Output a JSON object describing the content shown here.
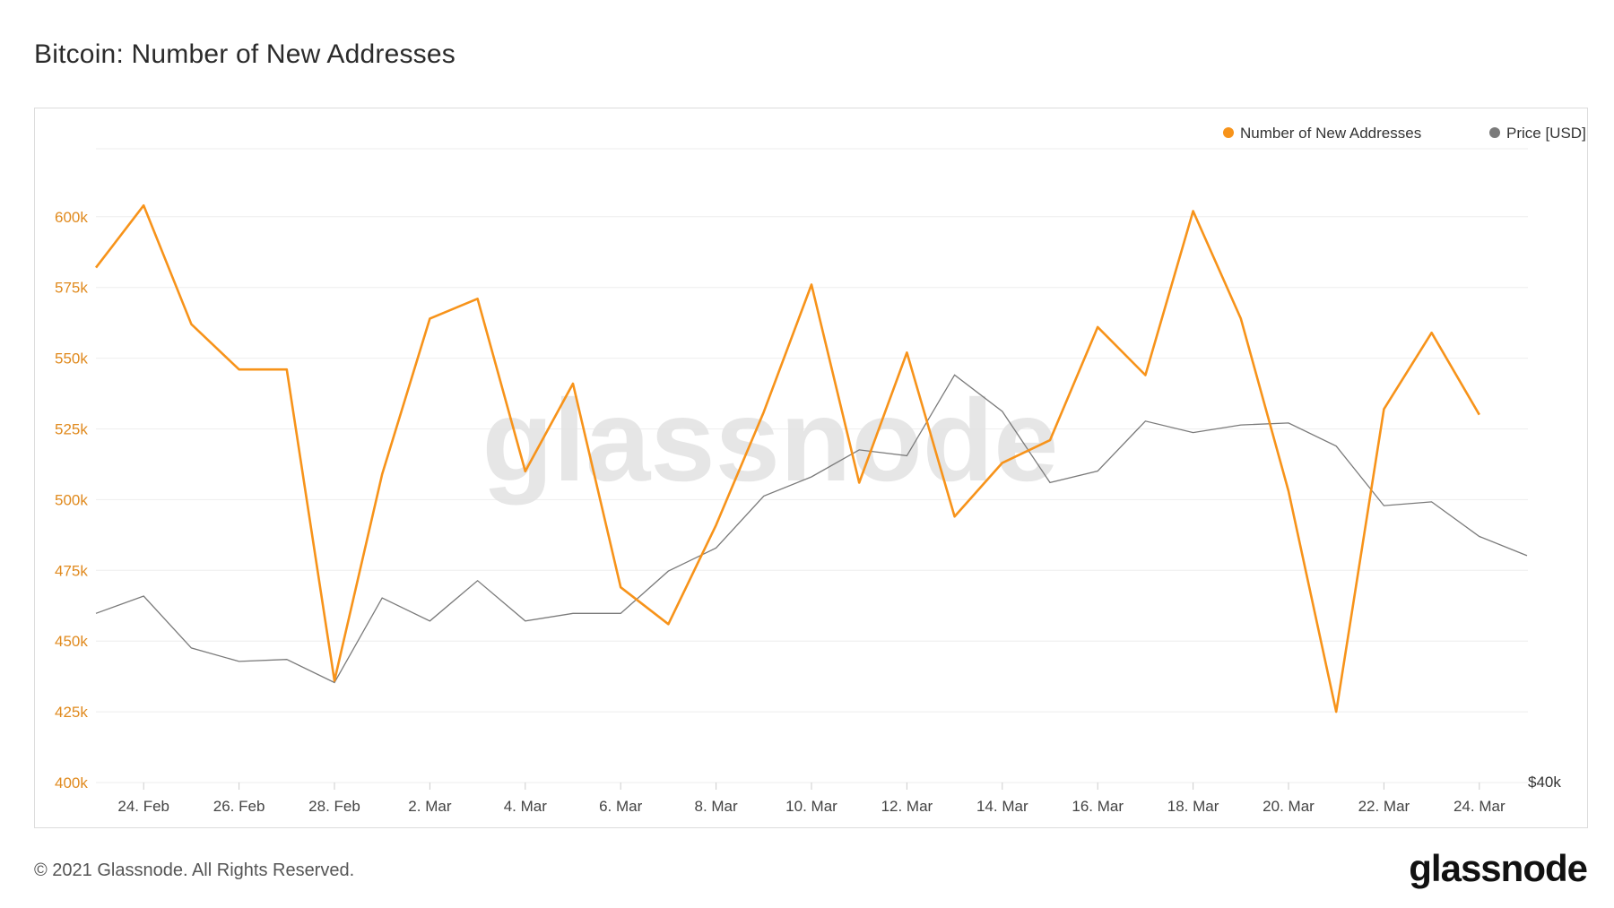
{
  "header": {
    "title": "Bitcoin: Number of New Addresses"
  },
  "footer": {
    "copyright": "© 2021 Glassnode. All Rights Reserved.",
    "logo_text": "glassnode"
  },
  "watermark": "glassnode",
  "colors": {
    "addresses": "#f7931a",
    "price": "#7a7a7a",
    "axis_text": "#e08a1e",
    "grid": "#eeeeee"
  },
  "chart_data": {
    "type": "line",
    "title": "Bitcoin: Number of New Addresses",
    "x_ticks": [
      "24. Feb",
      "26. Feb",
      "28. Feb",
      "2. Mar",
      "4. Mar",
      "6. Mar",
      "8. Mar",
      "10. Mar",
      "12. Mar",
      "14. Mar",
      "16. Mar",
      "18. Mar",
      "20. Mar",
      "22. Mar",
      "24. Mar"
    ],
    "y_ticks": [
      "400k",
      "425k",
      "450k",
      "475k",
      "500k",
      "525k",
      "550k",
      "575k",
      "600k"
    ],
    "ylim": [
      400000,
      625000
    ],
    "right_axis_label": "$40k",
    "legend_position": "top-right",
    "grid": true,
    "series": [
      {
        "name": "Number of New Addresses",
        "axis": "left",
        "x": [
          "2021-02-23",
          "2021-02-24",
          "2021-02-25",
          "2021-02-26",
          "2021-02-27",
          "2021-02-28",
          "2021-03-01",
          "2021-03-02",
          "2021-03-03",
          "2021-03-04",
          "2021-03-05",
          "2021-03-06",
          "2021-03-07",
          "2021-03-08",
          "2021-03-09",
          "2021-03-10",
          "2021-03-11",
          "2021-03-12",
          "2021-03-13",
          "2021-03-14",
          "2021-03-15",
          "2021-03-16",
          "2021-03-17",
          "2021-03-18",
          "2021-03-19",
          "2021-03-20",
          "2021-03-21",
          "2021-03-22",
          "2021-03-23",
          "2021-03-24"
        ],
        "values": [
          582000,
          604000,
          562000,
          546000,
          546000,
          436000,
          509000,
          564000,
          571000,
          510000,
          541000,
          469000,
          456000,
          491000,
          531000,
          576000,
          506000,
          552000,
          494000,
          513000,
          521000,
          561000,
          544000,
          602000,
          564000,
          503000,
          425000,
          532000,
          559000,
          530000
        ]
      },
      {
        "name": "Price [USD]",
        "axis": "right",
        "x": [
          "2021-02-23",
          "2021-02-24",
          "2021-02-25",
          "2021-02-26",
          "2021-02-27",
          "2021-02-28",
          "2021-03-01",
          "2021-03-02",
          "2021-03-03",
          "2021-03-04",
          "2021-03-05",
          "2021-03-06",
          "2021-03-07",
          "2021-03-08",
          "2021-03-09",
          "2021-03-10",
          "2021-03-11",
          "2021-03-12",
          "2021-03-13",
          "2021-03-14",
          "2021-03-15",
          "2021-03-16",
          "2021-03-17",
          "2021-03-18",
          "2021-03-19",
          "2021-03-20",
          "2021-03-21",
          "2021-03-22",
          "2021-03-23",
          "2021-03-24",
          "2021-03-25"
        ],
        "values": [
          48800,
          49700,
          47000,
          46300,
          46400,
          45200,
          49600,
          48400,
          50500,
          48400,
          48800,
          48800,
          51000,
          52200,
          54900,
          55900,
          57300,
          57000,
          61200,
          59300,
          55600,
          56200,
          58800,
          58200,
          58600,
          58700,
          57500,
          54400,
          54600,
          52800,
          51800
        ]
      }
    ]
  }
}
